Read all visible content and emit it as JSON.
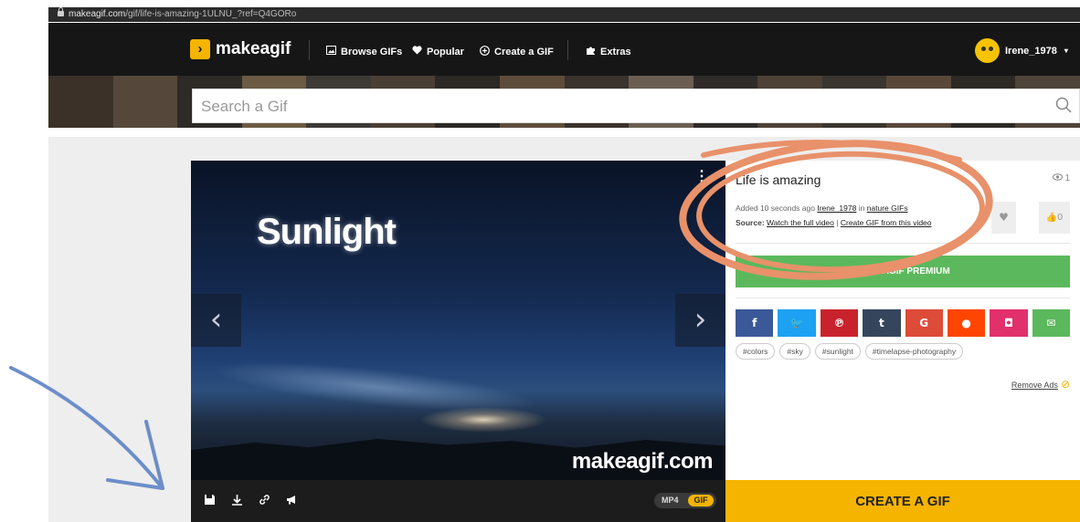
{
  "browser": {
    "url_host": "makeagif.com",
    "url_path": "/gif/life-is-amazing-1ULNU_?ref=Q4GORo"
  },
  "nav": {
    "logo_text": "makeagif",
    "logo_mark": "›",
    "items": [
      {
        "label": "Browse GIFs",
        "icon": "image-icon"
      },
      {
        "label": "Popular",
        "icon": "heart-icon"
      },
      {
        "label": "Create a GIF",
        "icon": "plus-circle-icon"
      },
      {
        "label": "Extras",
        "icon": "puzzle-icon"
      }
    ],
    "username": "Irene_1978"
  },
  "search": {
    "placeholder": "Search a Gif"
  },
  "gif": {
    "overlay_title": "Sunlight",
    "watermark": "makeagif.com",
    "format_mp4": "MP4",
    "format_gif": "GIF"
  },
  "details": {
    "title": "Life is amazing",
    "views": "1",
    "added_prefix": "Added 10 seconds ago ",
    "added_user": "Irene_1978",
    "added_in": " in ",
    "added_category": "nature GIFs",
    "source_label": "Source:",
    "source_link1": "Watch the full video",
    "source_sep": " | ",
    "source_link2": "Create GIF from this video",
    "likes": "0",
    "premium_label": "MAKEAGIF PREMIUM",
    "share_buttons": [
      {
        "label": "f",
        "color": "#3b5998",
        "name": "facebook"
      },
      {
        "label": "t",
        "color": "#1da1f2",
        "name": "twitter"
      },
      {
        "label": "p",
        "color": "#c8232c",
        "name": "pinterest"
      },
      {
        "label": "t",
        "color": "#35465c",
        "name": "tumblr"
      },
      {
        "label": "G",
        "color": "#dd4b39",
        "name": "google"
      },
      {
        "label": "r",
        "color": "#ff4500",
        "name": "reddit"
      },
      {
        "label": "◘",
        "color": "#e1306c",
        "name": "instagram"
      },
      {
        "label": "✉",
        "color": "#5cb85c",
        "name": "email"
      }
    ],
    "tags": [
      "#colors",
      "#sky",
      "#sunlight",
      "#timelapse-photography"
    ],
    "remove_ads": "Remove Ads",
    "create_button": "CREATE A GIF"
  },
  "colors": {
    "accent": "#f5b400",
    "premium": "#5cb85c",
    "annotation_circle": "#e8916a",
    "annotation_arrow": "#6c8ec9"
  }
}
